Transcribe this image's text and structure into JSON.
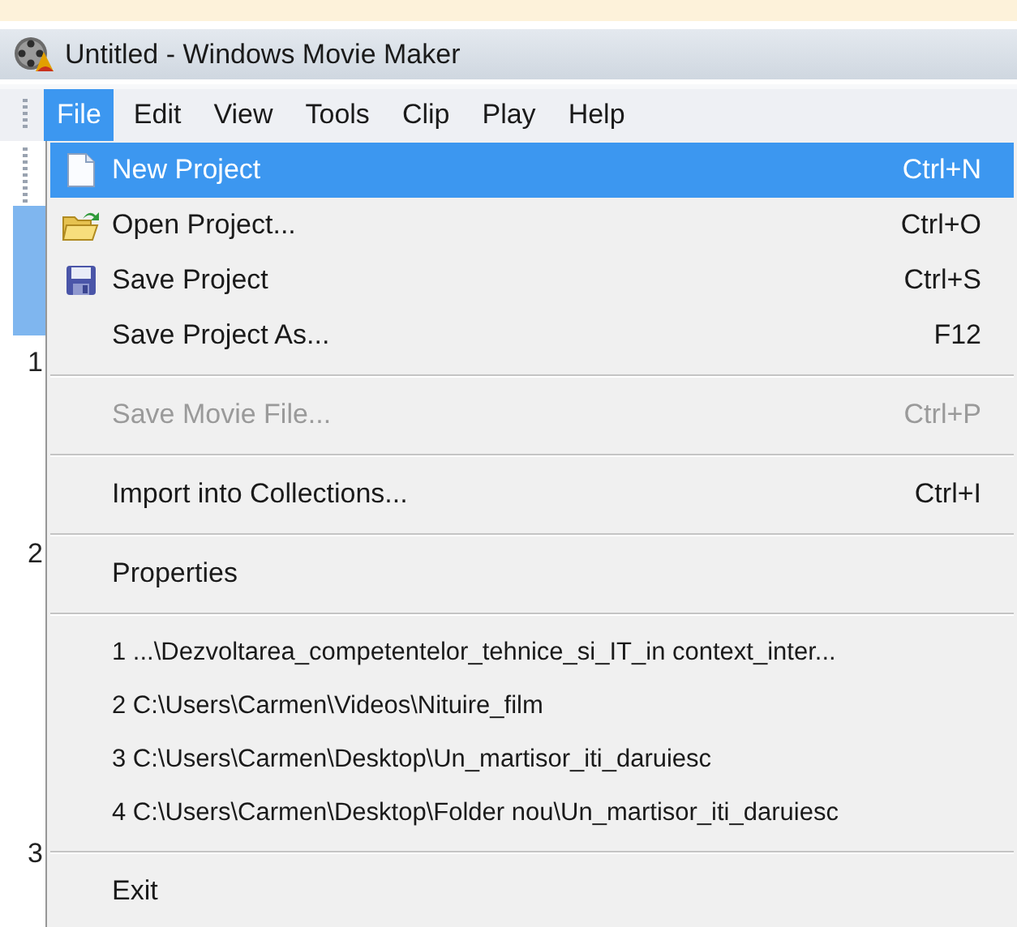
{
  "window": {
    "title": "Untitled - Windows Movie Maker"
  },
  "menubar": [
    {
      "label": "File",
      "selected": true
    },
    {
      "label": "Edit",
      "selected": false
    },
    {
      "label": "View",
      "selected": false
    },
    {
      "label": "Tools",
      "selected": false
    },
    {
      "label": "Clip",
      "selected": false
    },
    {
      "label": "Play",
      "selected": false
    },
    {
      "label": "Help",
      "selected": false
    }
  ],
  "background_markers": [
    "1",
    "2",
    "3"
  ],
  "file_menu": [
    {
      "kind": "item",
      "label": "New Project",
      "shortcut": "Ctrl+N",
      "selected": true,
      "disabled": false
    },
    {
      "kind": "item",
      "label": "Open Project...",
      "shortcut": "Ctrl+O",
      "selected": false,
      "disabled": false
    },
    {
      "kind": "item",
      "label": "Save Project",
      "shortcut": "Ctrl+S",
      "selected": false,
      "disabled": false
    },
    {
      "kind": "item",
      "label": "Save Project As...",
      "shortcut": "F12",
      "selected": false,
      "disabled": false
    },
    {
      "kind": "separator"
    },
    {
      "kind": "item",
      "label": "Save Movie File...",
      "shortcut": "Ctrl+P",
      "selected": false,
      "disabled": true
    },
    {
      "kind": "separator"
    },
    {
      "kind": "item",
      "label": "Import into Collections...",
      "shortcut": "Ctrl+I",
      "selected": false,
      "disabled": false
    },
    {
      "kind": "separator"
    },
    {
      "kind": "item",
      "label": "Properties",
      "selected": false,
      "disabled": false
    },
    {
      "kind": "separator"
    },
    {
      "kind": "recent",
      "label": "1 ...\\Dezvoltarea_competentelor_tehnice_si_IT_in context_inter...",
      "selected": false,
      "disabled": false
    },
    {
      "kind": "recent",
      "label": "2 C:\\Users\\Carmen\\Videos\\Nituire_film",
      "selected": false,
      "disabled": false
    },
    {
      "kind": "recent",
      "label": "3 C:\\Users\\Carmen\\Desktop\\Un_martisor_iti_daruiesc",
      "selected": false,
      "disabled": false
    },
    {
      "kind": "recent",
      "label": "4 C:\\Users\\Carmen\\Desktop\\Folder nou\\Un_martisor_iti_daruiesc",
      "selected": false,
      "disabled": false
    },
    {
      "kind": "separator"
    },
    {
      "kind": "item",
      "label": "Exit",
      "selected": false,
      "disabled": false
    }
  ]
}
